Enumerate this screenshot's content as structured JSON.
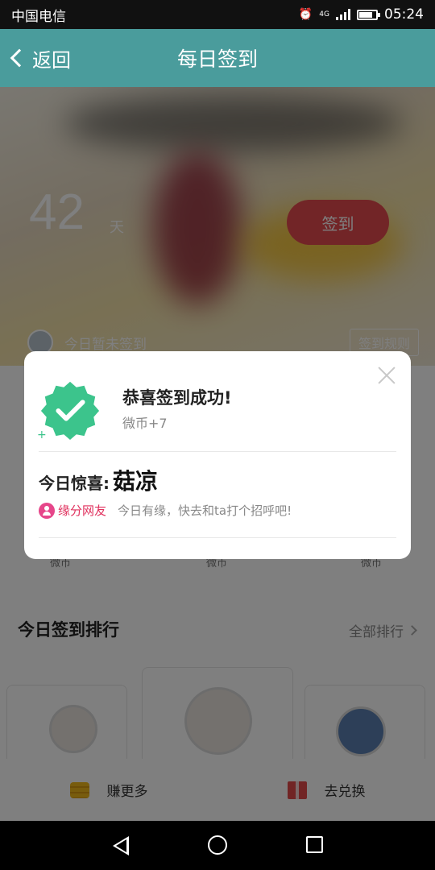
{
  "status_bar": {
    "carrier": "中国电信",
    "time": "05:24",
    "network": "4G",
    "icons": [
      "alarm-icon",
      "signal-icon",
      "battery-icon"
    ],
    "battery_level": 0.8
  },
  "nav": {
    "back_label": "返回",
    "title": "每日签到",
    "color": "#4a9c9c"
  },
  "hero": {
    "days": "42",
    "days_unit": "天",
    "sign_button": "签到",
    "status_text": "今日暂未签到",
    "rules_button": "签到规则"
  },
  "rewards": {
    "labels": [
      "微币",
      "微币",
      "微币"
    ]
  },
  "ranking": {
    "title": "今日签到排行",
    "all_link": "全部排行"
  },
  "bottom": {
    "earn_more": "赚更多",
    "redeem": "去兑换"
  },
  "modal": {
    "title": "恭喜签到成功!",
    "reward": "微币+7",
    "surprise_label": "今日惊喜:",
    "surprise_name": "菇凉",
    "friend_tag": "缘分网友",
    "friend_message": "今日有缘，快去和ta打个招呼吧!",
    "accent": "#3cc48c"
  }
}
